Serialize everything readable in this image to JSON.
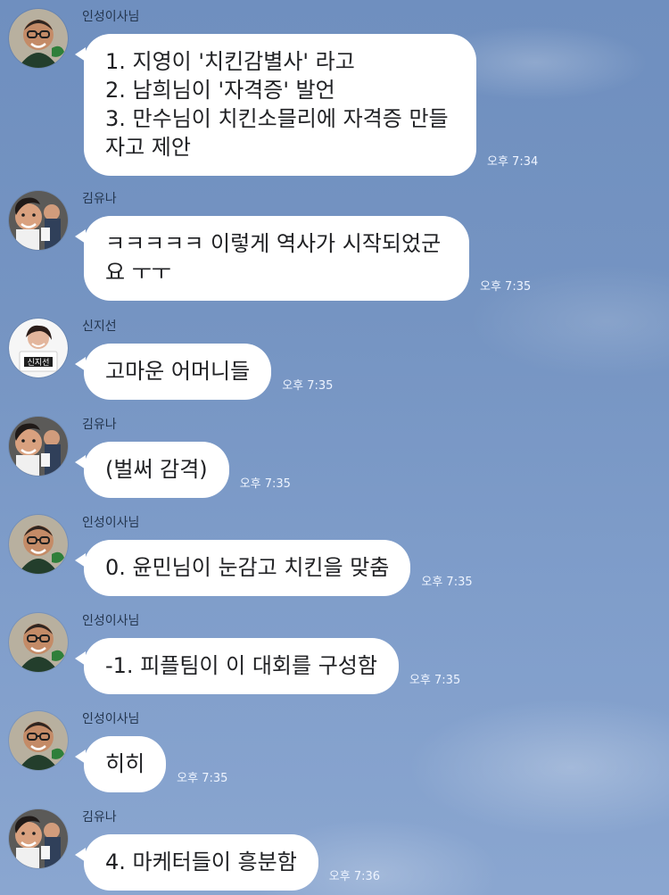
{
  "chat": {
    "messages": [
      {
        "sender": "인성이사님",
        "text": "1. 지영이 '치킨감별사' 라고\n2. 남희님이 '자격증' 발언\n3. 만수님이 치킨소믈리에 자격증 만들\n자고 제안",
        "time": "오후 7:34",
        "avatar": "avatar-icon"
      },
      {
        "sender": "김유나",
        "text": "ㅋㅋㅋㅋㅋ 이렇게 역사가 시작되었군\n요 ㅜㅜ",
        "time": "오후 7:35",
        "avatar": "avatar-icon"
      },
      {
        "sender": "신지선",
        "text": "고마운 어머니들",
        "time": "오후 7:35",
        "avatar": "avatar-icon",
        "avatar_badge_text": "신지선"
      },
      {
        "sender": "김유나",
        "text": "(벌써 감격)",
        "time": "오후 7:35",
        "avatar": "avatar-icon"
      },
      {
        "sender": "인성이사님",
        "text": "0. 윤민님이 눈감고 치킨을 맞춤",
        "time": "오후 7:35",
        "avatar": "avatar-icon"
      },
      {
        "sender": "인성이사님",
        "text": "-1. 피플팀이 이 대회를 구성함",
        "time": "오후 7:35",
        "avatar": "avatar-icon"
      },
      {
        "sender": "인성이사님",
        "text": "히히",
        "time": "오후 7:35",
        "avatar": "avatar-icon"
      },
      {
        "sender": "김유나",
        "text": "4. 마케터들이 흥분함",
        "time": "오후 7:36",
        "avatar": "avatar-icon"
      }
    ]
  }
}
